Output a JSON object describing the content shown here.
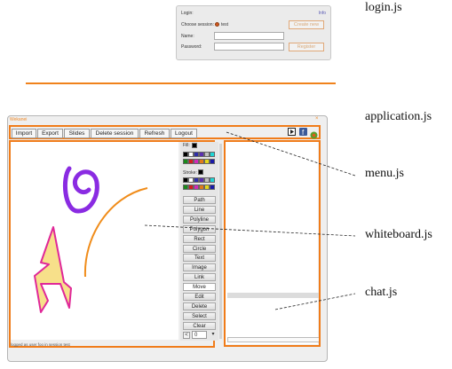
{
  "captions": {
    "login": "login.js",
    "application": "application.js",
    "menu": "menu.js",
    "whiteboard": "whiteboard.js",
    "chat": "chat.js"
  },
  "login": {
    "title": "Login:",
    "info": "Info",
    "choose_session_label": "Choose session:",
    "session_option": "test",
    "name_label": "Name:",
    "password_label": "Password:",
    "create_button": "Create new",
    "register_button": "Register"
  },
  "app": {
    "title": "Wekanei"
  },
  "menu": {
    "items": [
      "Import",
      "Export",
      "Slides",
      "Delete session",
      "Refresh",
      "Logout"
    ]
  },
  "toolbox": {
    "fill_label": "Fill:",
    "stroke_label": "Stroke:",
    "tools": [
      "Path",
      "Line",
      "Polyline",
      "Polygon",
      "Rect",
      "Circle",
      "Text",
      "Image",
      "Link",
      "Move",
      "Edit",
      "Delete",
      "Select",
      "Clear"
    ],
    "selected_tool": "Move",
    "page_number": "0",
    "palette_row1": [
      "#000000",
      "#ffffff",
      "#2f2fa8",
      "#5a2fb0",
      "#c0c0c0",
      "#1fd6d6"
    ],
    "palette_row2": [
      "#1a8a1a",
      "#d11e1e",
      "#d12ab8",
      "#e07a1a",
      "#e6d81a",
      "#1a1aa8"
    ]
  },
  "status": {
    "text": "logged as user foo in session test"
  },
  "colors": {
    "accent": "#f07c1a",
    "purple_stroke": "#8a2be2",
    "pink_stroke": "#e02898",
    "orange_stroke": "#f08c1a"
  }
}
